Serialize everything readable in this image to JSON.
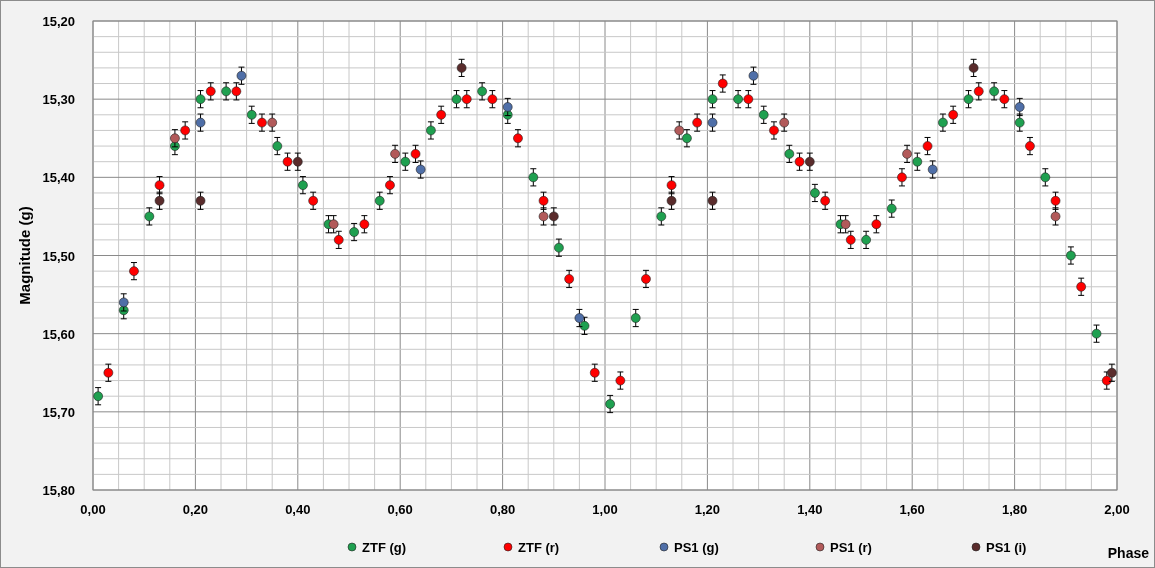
{
  "chart": {
    "chart_data": {
      "type": "scatter",
      "grid": true,
      "legend": "bottom",
      "xlabel": "Phase",
      "ylabel": "Magnitude (g)",
      "xlim": [
        0,
        2
      ],
      "ylim": [
        15.8,
        15.2
      ],
      "xticks": [
        {
          "value": 0,
          "label": "0,00"
        },
        {
          "value": 0.2,
          "label": "0,20"
        },
        {
          "value": 0.4,
          "label": "0,40"
        },
        {
          "value": 0.6,
          "label": "0,60"
        },
        {
          "value": 0.8,
          "label": "0,80"
        },
        {
          "value": 1,
          "label": "1,00"
        },
        {
          "value": 1.2,
          "label": "1,20"
        },
        {
          "value": 1.4,
          "label": "1,40"
        },
        {
          "value": 1.6,
          "label": "1,60"
        },
        {
          "value": 1.8,
          "label": "1,80"
        },
        {
          "value": 2,
          "label": "2,00"
        }
      ],
      "yticks": [
        {
          "value": 15.2,
          "label": "15,20"
        },
        {
          "value": 15.3,
          "label": "15,30"
        },
        {
          "value": 15.4,
          "label": "15,40"
        },
        {
          "value": 15.5,
          "label": "15,50"
        },
        {
          "value": 15.6,
          "label": "15,60"
        },
        {
          "value": 15.7,
          "label": "15,70"
        },
        {
          "value": 15.8,
          "label": "15,80"
        }
      ],
      "series": [
        {
          "name": "ZTF (g)",
          "color": "#1fa050",
          "x": [
            0.01,
            0.06,
            0.11,
            0.16,
            0.21,
            0.26,
            0.31,
            0.36,
            0.41,
            0.46,
            0.51,
            0.56,
            0.61,
            0.66,
            0.71,
            0.76,
            0.81,
            0.86,
            0.91,
            0.96,
            1.01,
            1.06,
            1.11,
            1.16,
            1.21,
            1.26,
            1.31,
            1.36,
            1.41,
            1.46,
            1.51,
            1.56,
            1.61,
            1.66,
            1.71,
            1.76,
            1.81,
            1.86,
            1.91,
            1.96
          ],
          "values": [
            15.68,
            15.57,
            15.45,
            15.36,
            15.3,
            15.29,
            15.32,
            15.36,
            15.41,
            15.46,
            15.47,
            15.43,
            15.38,
            15.34,
            15.3,
            15.29,
            15.32,
            15.4,
            15.49,
            15.59,
            15.69,
            15.58,
            15.45,
            15.35,
            15.3,
            15.3,
            15.32,
            15.37,
            15.42,
            15.46,
            15.48,
            15.44,
            15.38,
            15.33,
            15.3,
            15.29,
            15.33,
            15.4,
            15.5,
            15.6
          ]
        },
        {
          "name": "ZTF (r)",
          "color": "#ff0000",
          "x": [
            0.03,
            0.08,
            0.13,
            0.18,
            0.23,
            0.28,
            0.33,
            0.38,
            0.43,
            0.48,
            0.53,
            0.58,
            0.63,
            0.68,
            0.73,
            0.78,
            0.83,
            0.88,
            0.93,
            0.98,
            1.03,
            1.08,
            1.13,
            1.18,
            1.23,
            1.28,
            1.33,
            1.38,
            1.43,
            1.48,
            1.53,
            1.58,
            1.63,
            1.68,
            1.73,
            1.78,
            1.83,
            1.88,
            1.93,
            1.98
          ],
          "values": [
            15.65,
            15.52,
            15.41,
            15.34,
            15.29,
            15.29,
            15.33,
            15.38,
            15.43,
            15.48,
            15.46,
            15.41,
            15.37,
            15.32,
            15.3,
            15.3,
            15.35,
            15.43,
            15.53,
            15.65,
            15.66,
            15.53,
            15.41,
            15.33,
            15.28,
            15.3,
            15.34,
            15.38,
            15.43,
            15.48,
            15.46,
            15.4,
            15.36,
            15.32,
            15.29,
            15.3,
            15.36,
            15.43,
            15.54,
            15.66
          ]
        },
        {
          "name": "PS1 (g)",
          "color": "#4f6fa8",
          "x": [
            0.06,
            0.21,
            0.29,
            0.64,
            0.81,
            0.95,
            1.21,
            1.29,
            1.64,
            1.81
          ],
          "values": [
            15.56,
            15.33,
            15.27,
            15.39,
            15.31,
            15.58,
            15.33,
            15.27,
            15.39,
            15.31
          ]
        },
        {
          "name": "PS1 (r)",
          "color": "#b25a5a",
          "x": [
            0.16,
            0.35,
            0.47,
            0.59,
            0.88,
            1.145,
            1.35,
            1.47,
            1.59,
            1.88
          ],
          "values": [
            15.35,
            15.33,
            15.46,
            15.37,
            15.45,
            15.34,
            15.33,
            15.46,
            15.37,
            15.45
          ]
        },
        {
          "name": "PS1 (i)",
          "color": "#5a2c2c",
          "x": [
            0.13,
            0.21,
            0.4,
            0.72,
            0.9,
            1.13,
            1.21,
            1.4,
            1.72,
            1.99
          ],
          "values": [
            15.43,
            15.43,
            15.38,
            15.26,
            15.45,
            15.43,
            15.43,
            15.38,
            15.26,
            15.65
          ]
        }
      ]
    }
  }
}
